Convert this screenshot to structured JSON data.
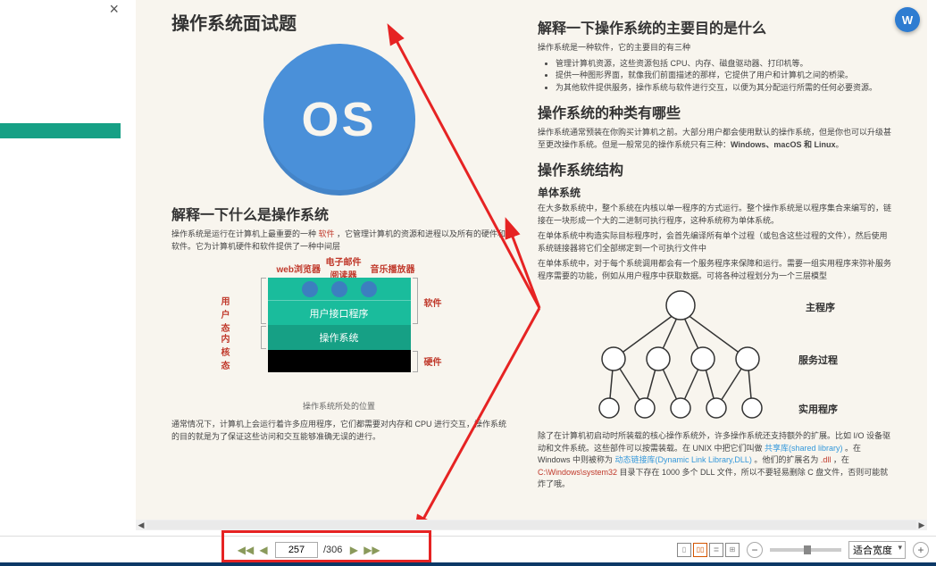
{
  "topbar": {
    "close": "×"
  },
  "floating": {
    "label": "W"
  },
  "left_page": {
    "h1": "操作系统面试题",
    "os_text": "OS",
    "h2": "解释一下什么是操作系统",
    "p1_a": "操作系统是运行在计算机上最重要的一种 ",
    "p1_kw": "软件",
    "p1_b": " ，它管理计算机的资源和进程以及所有的硬件和软件。它为计算机硬件和软件提供了一种中间层",
    "stack": {
      "web": "web浏览器",
      "mail": "电子邮件阅读器",
      "music": "音乐播放器",
      "user_mode": "用户态",
      "kernel_mode": "内核态",
      "software": "软件",
      "hardware": "硬件",
      "ui_layer": "用户接口程序",
      "os_layer": "操作系统",
      "caption": "操作系统所处的位置"
    },
    "p2": "通常情况下，计算机上会运行着许多应用程序，它们都需要对内存和 CPU 进行交互，操作系统的目的就是为了保证这些访问和交互能够准确无误的进行。"
  },
  "right_page": {
    "h1": "解释一下操作系统的主要目的是什么",
    "p1": "操作系统是一种软件，它的主要目的有三种",
    "li1": "管理计算机资源，这些资源包括 CPU、内存、磁盘驱动器、打印机等。",
    "li2": "提供一种图形界面，就像我们前面描述的那样，它提供了用户和计算机之间的桥梁。",
    "li3": "为其他软件提供服务，操作系统与软件进行交互，以便为其分配运行所需的任何必要资源。",
    "h2": "操作系统的种类有哪些",
    "p2_a": "操作系统通常预装在你购买计算机之前。大部分用户都会使用默认的操作系统，但是你也可以升级甚至更改操作系统。但是一般常见的操作系统只有三种：",
    "p2_b": "Windows、macOS 和 Linux",
    "p2_c": "。",
    "h3": "操作系统结构",
    "h3a": "单体系统",
    "p3": "在大多数系统中，整个系统在内核以单一程序的方式运行。整个操作系统是以程序集合来编写的，链接在一块形成一个大的二进制可执行程序，这种系统称为单体系统。",
    "p4": "在单体系统中构造实际目标程序时，会首先编译所有单个过程（或包含这些过程的文件），然后使用系统链接器将它们全部绑定到一个可执行文件中",
    "p5": "在单体系统中，对于每个系统调用都会有一个服务程序来保障和运行。需要一组实用程序来弥补服务程序需要的功能，例如从用户程序中获取数据。可将各种过程划分为一个三层模型",
    "tree": {
      "main": "主程序",
      "service": "服务过程",
      "util": "实用程序"
    },
    "p6_a": "除了在计算机初启动时所装载的核心操作系统外，许多操作系统还支持额外的扩展。比如 I/O 设备驱动和文件系统。这些部件可以按需装载。在 UNIX 中把它们叫做 ",
    "p6_l1": "共享库(shared library)",
    "p6_b": " 。在 Windows 中则被称为 ",
    "p6_l2": "动态链接库(Dynamic Link Library,DLL)",
    "p6_c": " 。他们的扩展名为 ",
    "p6_kw1": ".dll",
    "p6_d": " ，在 ",
    "p6_kw2": "C:\\Windows\\system32",
    "p6_e": " 目录下存在 1000 多个 DLL 文件，所以不要轻易删除 C 盘文件，否则可能就炸了哦。"
  },
  "pager": {
    "current": "257",
    "total": "/306"
  },
  "zoom": {
    "label": "适合宽度"
  }
}
